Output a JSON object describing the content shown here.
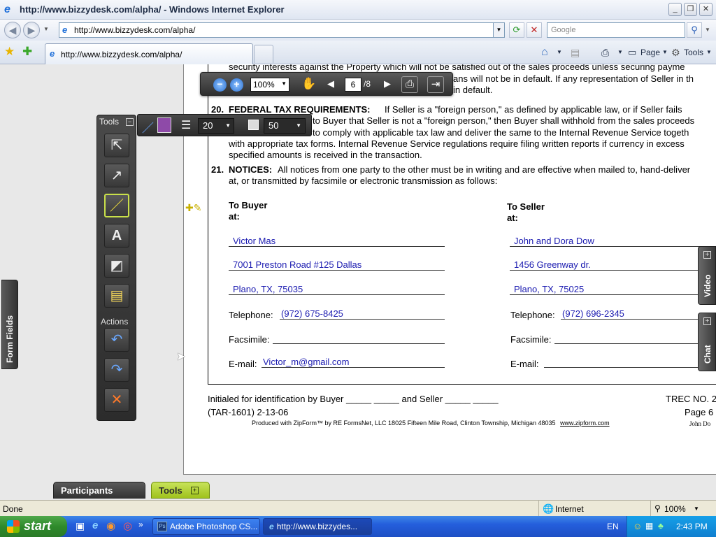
{
  "window": {
    "title": "http://www.bizzydesk.com/alpha/ - Windows Internet Explorer",
    "minimize": "_",
    "maximize": "❐",
    "close": "✕"
  },
  "addressbar": {
    "url": "http://www.bizzydesk.com/alpha/",
    "search_placeholder": "Google"
  },
  "tabs": [
    {
      "label": "http://www.bizzydesk.com/alpha/"
    }
  ],
  "commandbar": {
    "page": "Page",
    "tools": "Tools"
  },
  "viewer": {
    "zoom": "100%",
    "current_page": "6",
    "page_total": "/8"
  },
  "tools_panel": {
    "header": "Tools",
    "actions_label": "Actions",
    "tools": [
      "select-tool",
      "arrow-tool",
      "pen-tool",
      "text-tool",
      "shape-tool",
      "note-tool"
    ],
    "active_tool": "pen-tool"
  },
  "pen_options": {
    "size": "20",
    "opacity": "50",
    "color": "#8e4aa8"
  },
  "side_tabs": {
    "form_fields": "Form Fields",
    "video": "Video",
    "chat": "Chat"
  },
  "bottom_tabs": {
    "participants": "Participants",
    "tools": "Tools"
  },
  "document": {
    "top_line": "security interests against the Property which will not be satisfied out of the sales proceeds unless securing payme",
    "line2": "ans will not be in default. If any representation of Seller in th",
    "line3": "in default.",
    "sec20_num": "20.",
    "sec20_head": "FEDERAL TAX REQUIREMENTS:",
    "sec20_l1": "If Seller is a \"foreign person,\" as defined by applicable law, or if Seller fails",
    "sec20_l2": "to Buyer that Seller is not a \"foreign person,\" then Buyer shall withhold from the sales proceeds",
    "sec20_l3": "to comply with applicable tax law and deliver the same to the Internal Revenue Service togeth",
    "sec20_l4": "with appropriate tax forms. Internal Revenue Service regulations require filing written reports if currency in excess",
    "sec20_l5": "specified amounts is received in the transaction.",
    "sec21_num": "21.",
    "sec21_head": "NOTICES:",
    "sec21_l1": "All notices from one party to the other must be in writing and are effective when mailed to, hand-deliver",
    "sec21_l2": "at, or transmitted by facsimile or electronic transmission as follows:",
    "buyer_head1": "To Buyer",
    "buyer_head2": "at:",
    "seller_head1": "To Seller",
    "seller_head2": "at:",
    "buyer": {
      "name": "Victor Mas",
      "address1": "7001 Preston Road #125 Dallas",
      "address2": "Plano, TX, 75035",
      "telephone": "(972) 675-8425",
      "email": "Victor_m@gmail.com"
    },
    "seller": {
      "name": "John and Dora Dow",
      "address1": "1456 Greenway dr.",
      "address2": "Plano, TX, 75025",
      "telephone": "(972) 696-2345"
    },
    "label_telephone": "Telephone:",
    "label_facsimile": "Facsimile:",
    "label_email": "E-mail:",
    "initialed": "Initialed for identification by Buyer  _____  _____  and Seller  _____  _____",
    "trec": "TREC NO. 2",
    "tar": "(TAR-1601) 2-13-06",
    "page": "Page 6",
    "produced": "Produced with ZipForm™ by RE FormsNet, LLC 18025 Fifteen Mile Road, Clinton Township, Michigan 48035",
    "produced_link": "www.zipform.com",
    "footer_name": "John Do"
  },
  "statusbar": {
    "left": "Done",
    "zone": "Internet",
    "zoom": "100%"
  },
  "taskbar": {
    "start": "start",
    "items": [
      "Adobe Photoshop CS...",
      "http://www.bizzydes..."
    ],
    "lang": "EN",
    "time": "2:43 PM"
  }
}
